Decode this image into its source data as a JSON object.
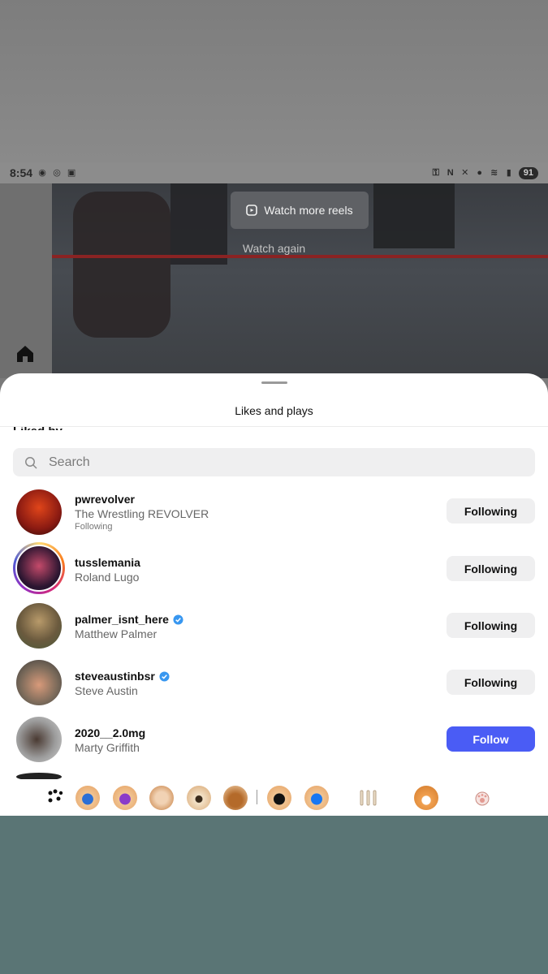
{
  "status_bar": {
    "time": "8:54",
    "battery": "91"
  },
  "video": {
    "watch_more_label": "Watch more reels",
    "watch_again_label": "Watch again"
  },
  "sheet": {
    "title": "Likes and plays",
    "section_label": "Liked by",
    "search_placeholder": "Search"
  },
  "users": [
    {
      "username": "pwrevolver",
      "full_name": "The Wrestling REVOLVER",
      "subtext": "Following",
      "verified": false,
      "button": "Following",
      "avatar_color": "#8a1a12"
    },
    {
      "username": "tusslemania",
      "full_name": "Roland Lugo",
      "subtext": "",
      "verified": false,
      "button": "Following",
      "avatar_color": "#2a1530"
    },
    {
      "username": "palmer_isnt_here",
      "full_name": "Matthew Palmer",
      "subtext": "",
      "verified": true,
      "button": "Following",
      "avatar_color": "#6b5a3e"
    },
    {
      "username": "steveaustinbsr",
      "full_name": "Steve Austin",
      "subtext": "",
      "verified": true,
      "button": "Following",
      "avatar_color": "#7a6a5a"
    },
    {
      "username": "2020__2.0mg",
      "full_name": "Marty Griffith",
      "subtext": "",
      "verified": false,
      "button": "Follow",
      "avatar_color": "#9c9c9c"
    }
  ],
  "colors": {
    "follow_button": "#4a5cf5",
    "verified_badge": "#3897f0"
  },
  "emoji_bar": {
    "icons": [
      "paw-prints-icon",
      "corgi-chat-icon",
      "corgi-mail-icon",
      "corgi-phone-icon",
      "corgi-camera-icon",
      "corgi-bowl-icon",
      "corgi-tiktok-icon",
      "corgi-facebook-icon",
      "bones-icon",
      "corgi-face-icon",
      "paw-icon"
    ]
  }
}
